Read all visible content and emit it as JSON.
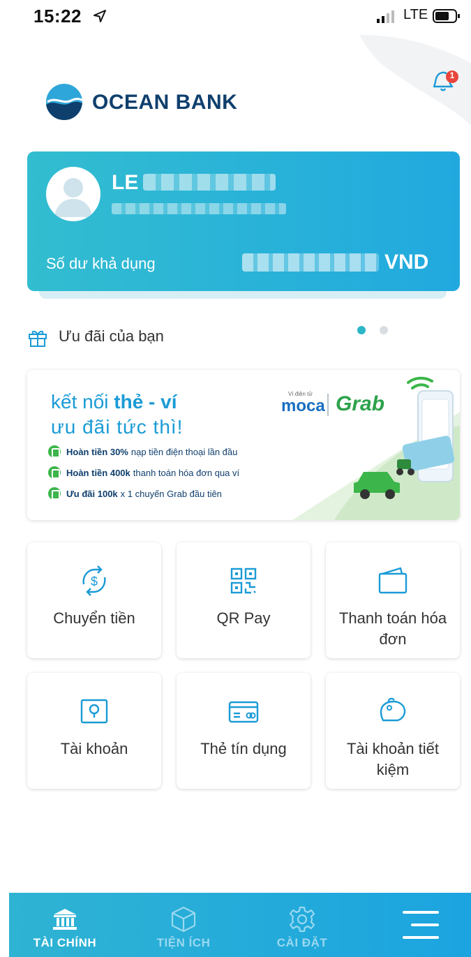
{
  "status_bar": {
    "time": "15:22",
    "network": "LTE"
  },
  "header": {
    "logo_text": "OCEAN BANK",
    "notification_count": "1"
  },
  "account": {
    "name_visible": "LE",
    "balance_label": "Số dư khả dụng",
    "currency": "VND"
  },
  "offers": {
    "title": "Ưu đãi của bạn",
    "banner": {
      "headline_prefix": "kết nối",
      "headline_strong": "thẻ - ví",
      "subheadline": "ưu đãi tức thì!",
      "moca_caption": "Ví điện tử",
      "moca": "moca",
      "grab": "Grab",
      "lines": [
        {
          "strong": "Hoàn tiền 30%",
          "text": "nạp tiền điện thoại lần đầu"
        },
        {
          "strong": "Hoàn tiền 400k",
          "text": "thanh toán hóa đơn qua ví"
        },
        {
          "strong": "Ưu đãi 100k",
          "text": "x 1 chuyến Grab đầu tiên"
        }
      ]
    }
  },
  "tiles": [
    {
      "label": "Chuyển tiền",
      "icon": "money-transfer-icon"
    },
    {
      "label": "QR Pay",
      "icon": "qr-code-icon"
    },
    {
      "label": "Thanh toán hóa đơn",
      "icon": "wallet-icon"
    },
    {
      "label": "Tài khoản",
      "icon": "account-safe-icon"
    },
    {
      "label": "Thẻ tín dụng",
      "icon": "credit-card-icon"
    },
    {
      "label": "Tài khoản tiết kiệm",
      "icon": "piggy-bank-icon"
    }
  ],
  "bottom_nav": [
    {
      "label": "TÀI CHÍNH",
      "icon": "bank-icon",
      "active": true
    },
    {
      "label": "TIỆN ÍCH",
      "icon": "cube-icon",
      "active": false
    },
    {
      "label": "CÀI ĐẶT",
      "icon": "gear-icon",
      "active": false
    },
    {
      "label": "",
      "icon": "menu-icon",
      "active": false
    }
  ],
  "colors": {
    "brand_navy": "#0f3f6d",
    "accent_blue": "#1a9bd6",
    "card_gradient_start": "#33bdd0",
    "card_gradient_end": "#21a9df",
    "nav_active": "#ffffff",
    "nav_inactive": "#9ad8f0"
  }
}
